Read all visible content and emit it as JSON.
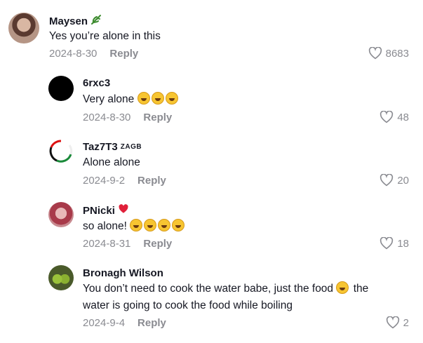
{
  "comments": [
    {
      "name": "Maysen",
      "name_suffix_icon": "leaf-icon",
      "text": "Yes you’re alone in this",
      "date": "2024-8-30",
      "reply": "Reply",
      "likes": "8683",
      "avatar": "user-photo-avatar"
    },
    {
      "name": "6rxc3",
      "text": "Very alone",
      "emojis": [
        "rofl-emoji",
        "rofl-emoji",
        "rofl-emoji"
      ],
      "date": "2024-8-30",
      "reply": "Reply",
      "likes": "48",
      "avatar": "black-circle-avatar"
    },
    {
      "name": "Taz7T3",
      "name_suffix": "ZAGB",
      "text": "Alone alone",
      "date": "2024-9-2",
      "reply": "Reply",
      "likes": "20",
      "avatar": "ring-avatar"
    },
    {
      "name": "PNicki",
      "name_suffix_icon": "heart-emoji-icon",
      "text": "so alone!",
      "emojis": [
        "rofl-emoji",
        "rofl-emoji",
        "rofl-emoji",
        "rofl-emoji"
      ],
      "date": "2024-8-31",
      "reply": "Reply",
      "likes": "18",
      "avatar": "user-photo-avatar"
    },
    {
      "name": "Bronagh Wilson",
      "text_line1": "You don’t need to cook the water babe, just the food",
      "text_line1_emoji": "laughing-emoji",
      "text_line1_end": "the",
      "text_line2": "water is going to cook the food while boiling",
      "date": "2024-9-4",
      "reply": "Reply",
      "likes": "2",
      "avatar": "pears-avatar"
    }
  ],
  "colors": {
    "text": "#161823",
    "muted": "#8a8b91",
    "background": "#ffffff"
  }
}
